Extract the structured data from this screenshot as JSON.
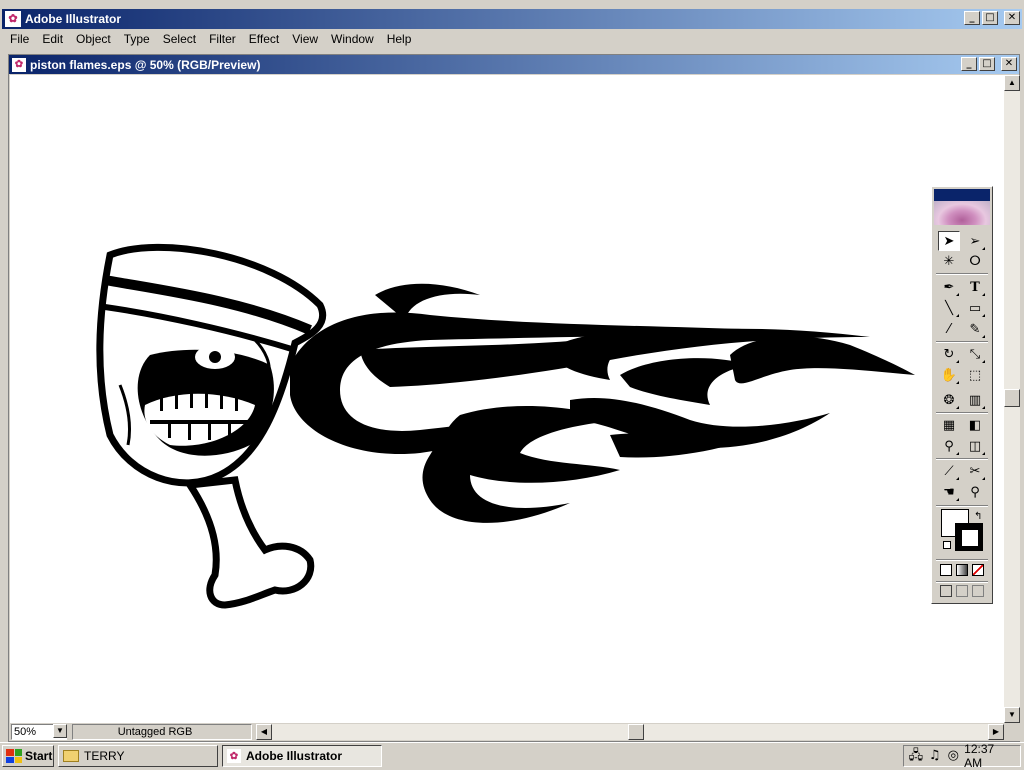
{
  "window": {
    "title": "Adobe Illustrator",
    "controls": [
      "_",
      "□",
      "✕"
    ]
  },
  "menu": [
    "File",
    "Edit",
    "Object",
    "Type",
    "Select",
    "Filter",
    "Effect",
    "View",
    "Window",
    "Help"
  ],
  "document": {
    "title": "piston flames.eps @ 50% (RGB/Preview)"
  },
  "status": {
    "zoom": "50%",
    "profile": "Untagged RGB"
  },
  "toolbox": {
    "tools": [
      {
        "name": "selection-tool",
        "glyph": "➤"
      },
      {
        "name": "direct-selection-tool",
        "glyph": "➢"
      },
      {
        "name": "magic-wand-tool",
        "glyph": "✳"
      },
      {
        "name": "lasso-tool",
        "glyph": "ⵔ"
      },
      {
        "name": "pen-tool",
        "glyph": "✒"
      },
      {
        "name": "type-tool",
        "glyph": "T"
      },
      {
        "name": "line-tool",
        "glyph": "╲"
      },
      {
        "name": "rectangle-tool",
        "glyph": "▭"
      },
      {
        "name": "paintbrush-tool",
        "glyph": "⁄"
      },
      {
        "name": "pencil-tool",
        "glyph": "✎"
      },
      {
        "name": "rotate-tool",
        "glyph": "↻"
      },
      {
        "name": "scale-tool",
        "glyph": "⤡"
      },
      {
        "name": "warp-tool",
        "glyph": "✋"
      },
      {
        "name": "free-transform-tool",
        "glyph": "⬚"
      },
      {
        "name": "symbol-sprayer-tool",
        "glyph": "❂"
      },
      {
        "name": "graph-tool",
        "glyph": "▥"
      },
      {
        "name": "mesh-tool",
        "glyph": "▦"
      },
      {
        "name": "gradient-tool",
        "glyph": "◧"
      },
      {
        "name": "eyedropper-tool",
        "glyph": "⚲"
      },
      {
        "name": "blend-tool",
        "glyph": "◫"
      },
      {
        "name": "slice-tool",
        "glyph": "⟋"
      },
      {
        "name": "scissors-tool",
        "glyph": "✂"
      },
      {
        "name": "hand-tool",
        "glyph": "☚"
      },
      {
        "name": "zoom-tool",
        "glyph": "⚲"
      }
    ]
  },
  "taskbar": {
    "start": "Start",
    "buttons": [
      "TERRY",
      "Adobe Illustrator"
    ],
    "clock": "12:37 AM"
  }
}
